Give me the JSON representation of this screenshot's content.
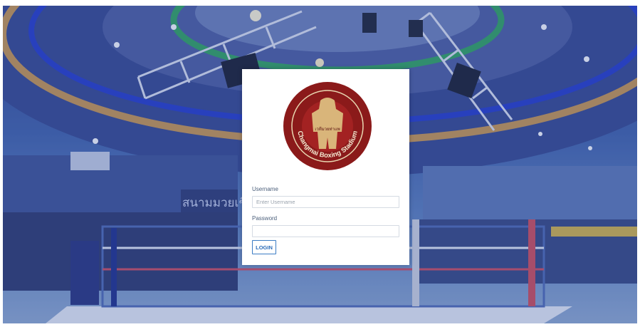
{
  "brand": {
    "logo_ring_text": "Changmai Boxing Stadium",
    "logo_thai_text": "เวทีมวยท่าแพ",
    "venue_banner_text": "สนามมวยเชียงใหม่"
  },
  "login": {
    "username_label": "Username",
    "username_placeholder": "Enter Username",
    "username_value": "",
    "password_label": "Password",
    "password_value": "",
    "login_button": "LOGIN"
  },
  "colors": {
    "overlay": "#3a57a3",
    "logo_red": "#8b1a1a",
    "accent": "#2b6cb8"
  }
}
